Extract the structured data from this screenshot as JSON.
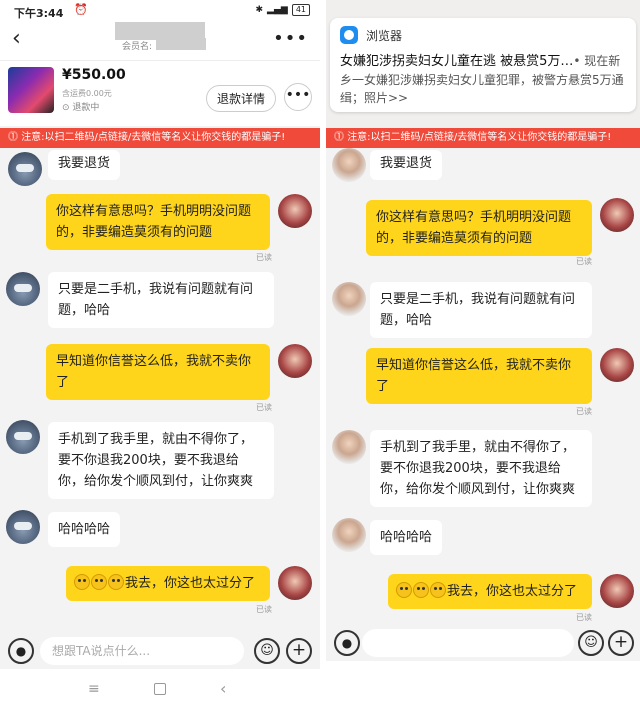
{
  "status_bar": {
    "time": "下午3:44",
    "battery": "41"
  },
  "header": {
    "member_label": "会员名:"
  },
  "product": {
    "price": "¥550.00",
    "shipping": "含运费0.00元",
    "state": "退款中",
    "detail_button": "退款详情",
    "more_button": "•••"
  },
  "warning": "注意:以扫二维码/点链接/去微信等名义让你交钱的都是骗子!",
  "messages": [
    {
      "side": "in",
      "text": "我要退货"
    },
    {
      "side": "out",
      "text": "你这样有意思吗？手机明明没问题的，非要编造莫须有的问题",
      "read": "已读"
    },
    {
      "side": "in",
      "text": "只要是二手机，我说有问题就有问题，哈哈"
    },
    {
      "side": "out",
      "text": "早知道你信誉这么低，我就不卖你了",
      "read": "已读"
    },
    {
      "side": "in",
      "text": "手机到了我手里，就由不得你了，要不你退我200块，要不我退给你，给你发个顺风到付，让你爽爽"
    },
    {
      "side": "in",
      "text": "哈哈哈哈"
    },
    {
      "side": "out",
      "text": "我去，你这也太过分了",
      "read": "已读"
    }
  ],
  "input": {
    "placeholder": "想跟TA说点什么..."
  },
  "notification": {
    "app": "浏览器",
    "title": "女嫌犯涉拐卖妇女儿童在逃 被悬赏5万…",
    "body": "• 现在新乡一女嫌犯涉嫌拐卖妇女儿童犯罪，被警方悬赏5万通缉；照片>>"
  },
  "right_messages": [
    {
      "text": "我要退货"
    },
    {
      "text": "你这样有意思吗？手机明明没问题的，非要编造莫须有的问题",
      "read": "已读"
    },
    {
      "text": "只要是二手机，我说有问题就有问题，哈哈"
    },
    {
      "text": "早知道你信誉这么低，我就不卖你了",
      "read": "已读"
    },
    {
      "text": "手机到了我手里，就由不得你了，要不你退我200块，要不我退给你，给你发个顺风到付，让你爽爽"
    },
    {
      "text": "哈哈哈哈"
    },
    {
      "text": "我去，你这也太过分了",
      "read": "已读"
    }
  ],
  "icons": {
    "back": "back-arrow-icon",
    "more": "more-icon",
    "mic": "mic-icon",
    "emoji": "emoji-icon",
    "plus": "plus-icon",
    "browser": "browser-icon"
  },
  "colors": {
    "accent": "#ffd51b",
    "warning": "#f04a3b",
    "notif_icon": "#1f8cf0"
  }
}
